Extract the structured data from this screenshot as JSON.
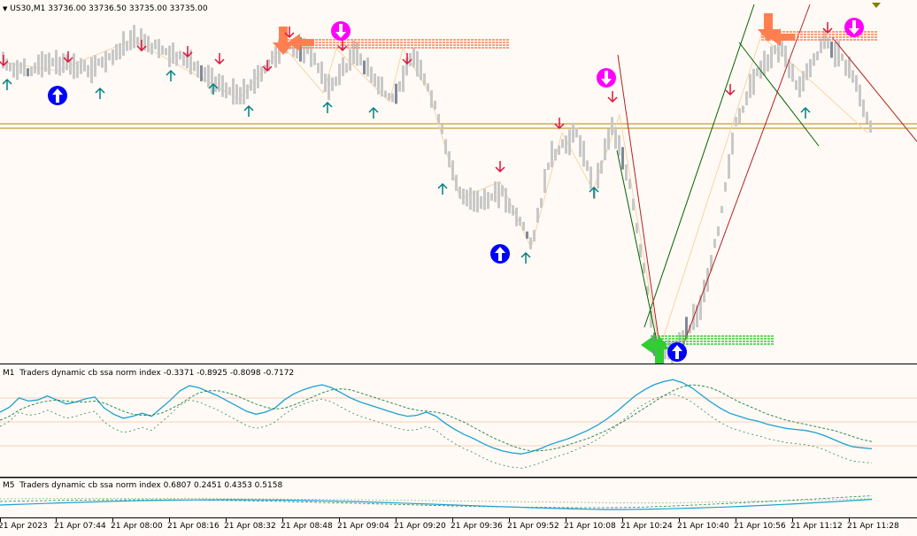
{
  "main": {
    "symbol": "US30,M1",
    "ohlc": "33736.00 33736.50 33735.00 33735.00",
    "collapse_glyph": "▼"
  },
  "indicator1": {
    "timeframe": "M1",
    "name": "Traders dynamic cb ssa norm index",
    "values": "-0.3371 -0.8925 -0.8098 -0.7172"
  },
  "indicator2": {
    "timeframe": "M5",
    "name": "Traders dynamic cb ssa norm index",
    "values": "0.6807 0.2451 0.4353 0.5158"
  },
  "time_axis": [
    "21 Apr 2023",
    "21 Apr 07:44",
    "21 Apr 08:00",
    "21 Apr 08:16",
    "21 Apr 08:32",
    "21 Apr 08:48",
    "21 Apr 09:04",
    "21 Apr 09:20",
    "21 Apr 09:36",
    "21 Apr 09:52",
    "21 Apr 10:08",
    "21 Apr 10:24",
    "21 Apr 10:40",
    "21 Apr 10:56",
    "21 Apr 11:12",
    "21 Apr 11:28"
  ],
  "colors": {
    "background": "#fffaf5",
    "bar": "#c8c8c8",
    "bar_dark": "#7f8a99",
    "arrow_down": "#dc143c",
    "arrow_up": "#008080",
    "big_up": "#0000ff",
    "big_down": "#ff00ff",
    "orange": "#ff7f50",
    "green": "#32cd32",
    "level": "#b8860b",
    "indicator": "#1ba1d4"
  },
  "chart_data": {
    "type": "line",
    "series": [
      {
        "values": [
          60,
          65,
          74,
          71,
          72,
          76,
          72,
          68,
          70,
          73,
          75,
          64,
          58,
          54,
          56,
          59,
          56,
          64,
          72,
          81,
          86,
          84,
          80,
          76,
          71,
          66,
          61,
          58,
          60,
          64,
          72,
          78,
          82,
          85,
          87,
          84,
          79,
          74,
          70,
          67,
          64,
          61,
          58,
          56,
          57,
          60,
          56,
          49,
          43,
          38,
          34,
          29,
          25,
          22,
          20,
          19,
          21,
          24,
          28,
          31,
          34,
          38,
          42,
          47,
          53,
          60,
          68,
          76,
          82,
          87,
          90,
          92,
          89,
          84,
          77,
          70,
          64,
          59,
          56,
          53,
          51,
          48,
          46,
          44,
          43,
          42,
          40,
          37,
          33,
          29,
          26,
          25,
          24
        ]
      },
      {
        "values": [
          52,
          56,
          62,
          66,
          69,
          71,
          72,
          71,
          70,
          70,
          71,
          69,
          65,
          61,
          58,
          57,
          57,
          59,
          63,
          68,
          74,
          79,
          81,
          81,
          79,
          76,
          72,
          68,
          65,
          63,
          64,
          67,
          71,
          75,
          79,
          82,
          83,
          82,
          79,
          76,
          73,
          70,
          67,
          64,
          62,
          61,
          60,
          58,
          54,
          50,
          45,
          40,
          35,
          31,
          27,
          24,
          22,
          22,
          23,
          25,
          28,
          31,
          34,
          38,
          42,
          47,
          52,
          58,
          64,
          70,
          76,
          81,
          85,
          87,
          86,
          84,
          80,
          75,
          70,
          66,
          62,
          58,
          55,
          52,
          50,
          48,
          46,
          44,
          42,
          39,
          36,
          33,
          31
        ]
      }
    ]
  }
}
